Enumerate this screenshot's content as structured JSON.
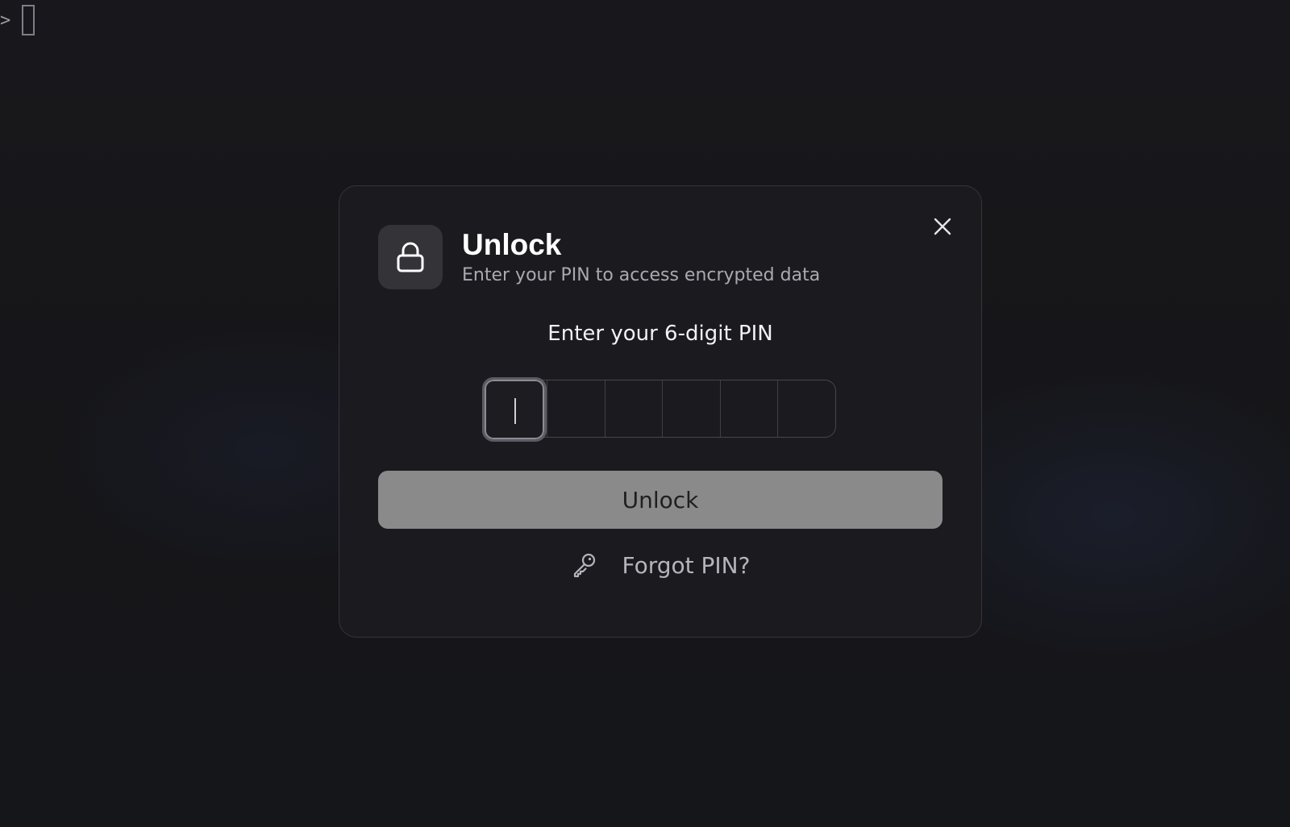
{
  "terminal": {
    "prompt_symbol": ">"
  },
  "dialog": {
    "title": "Unlock",
    "subtitle": "Enter your PIN to access encrypted data",
    "lock_icon": "lock-icon",
    "close_icon": "close-icon",
    "pin": {
      "label": "Enter your 6-digit PIN",
      "length": 6,
      "values": [
        "",
        "",
        "",
        "",
        "",
        ""
      ],
      "active_index": 0
    },
    "unlock_button": {
      "label": "Unlock",
      "enabled": false
    },
    "forgot": {
      "label": "Forgot PIN?",
      "icon": "key-icon"
    }
  },
  "colors": {
    "background": "#17171b",
    "dialog_background": "#1b1b1f",
    "dialog_border": "#34343a",
    "button_disabled": "#8a8a8a",
    "text_primary": "#ffffff",
    "text_secondary": "#a9a9b0"
  }
}
